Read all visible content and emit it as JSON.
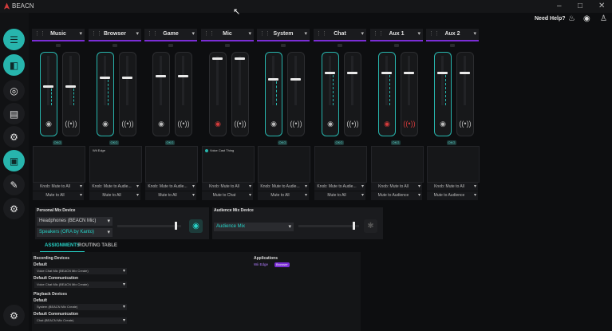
{
  "window": {
    "title": "BEACN",
    "brand_color": "#d13c3c",
    "controls": [
      "minimize-icon",
      "maximize-icon",
      "close-icon"
    ]
  },
  "header": {
    "help_label": "Need Help?",
    "icons": [
      "headset-icon",
      "discord-icon",
      "user-icon"
    ]
  },
  "sidebar": {
    "items": [
      {
        "name": "mixer",
        "icon": "sliders-icon",
        "active": true
      },
      {
        "name": "fader",
        "icon": "fader-icon",
        "active": true
      },
      {
        "name": "fx",
        "icon": "fx-icon",
        "active": false
      },
      {
        "name": "device-settings",
        "icon": "device-gear-icon",
        "active": false
      },
      {
        "name": "settings",
        "icon": "gear-icon",
        "active": false
      },
      {
        "name": "screen",
        "icon": "monitor-icon",
        "active": true
      },
      {
        "name": "edit",
        "icon": "edit-icon",
        "active": false
      },
      {
        "name": "more-settings",
        "icon": "gear-icon",
        "active": false
      },
      {
        "name": "app-settings",
        "icon": "gear-icon",
        "active": false
      }
    ]
  },
  "colors": {
    "accent": "#27b5ad",
    "purple": "#7b2dd6",
    "red": "#d43b3b"
  },
  "channels": [
    {
      "name": "Music",
      "personal_level": 0.4,
      "stream_level": 0.4,
      "personal_muted": false,
      "stream_muted": false,
      "panel_text": "",
      "panel_dot": false,
      "route1": "Knob: Mute to All",
      "route2": "Mute to All",
      "link_label": "OKG",
      "highlight": true
    },
    {
      "name": "Browser",
      "personal_level": 0.58,
      "stream_level": 0.58,
      "personal_muted": false,
      "stream_muted": false,
      "panel_text": "Wii Edge",
      "panel_dot": false,
      "route1": "Knob: Mute to Audie...",
      "route2": "Mute to All",
      "link_label": "OKG",
      "highlight": true
    },
    {
      "name": "Game",
      "personal_level": 0.62,
      "stream_level": 0.62,
      "personal_muted": false,
      "stream_muted": false,
      "panel_text": "",
      "panel_dot": false,
      "route1": "Knob: Mute to Audie...",
      "route2": "Mute to All",
      "link_label": "OKG",
      "highlight": false
    },
    {
      "name": "Mic",
      "personal_level": 0.97,
      "stream_level": 0.97,
      "personal_muted": true,
      "stream_muted": false,
      "panel_text": "Voice Cast Thing",
      "panel_dot": true,
      "route1": "Knob: Mute to All",
      "route2": "Mute to Chat",
      "link_label": "",
      "highlight": false
    },
    {
      "name": "System",
      "personal_level": 0.55,
      "stream_level": 0.55,
      "personal_muted": false,
      "stream_muted": false,
      "panel_text": "",
      "panel_dot": false,
      "route1": "Knob: Mute to Audie...",
      "route2": "Mute to All",
      "link_label": "OKG",
      "highlight": true
    },
    {
      "name": "Chat",
      "personal_level": 0.68,
      "stream_level": 0.68,
      "personal_muted": false,
      "stream_muted": false,
      "panel_text": "",
      "panel_dot": false,
      "route1": "Knob: Mute to Audie...",
      "route2": "Mute to All",
      "link_label": "OKG",
      "highlight": true
    },
    {
      "name": "Aux 1",
      "personal_level": 0.68,
      "stream_level": 0.68,
      "personal_muted": true,
      "stream_muted": true,
      "panel_text": "",
      "panel_dot": false,
      "route1": "Knob: Mute to All",
      "route2": "Mute to Audience",
      "link_label": "OKG",
      "highlight": true
    },
    {
      "name": "Aux 2",
      "personal_level": 0.68,
      "stream_level": 0.68,
      "personal_muted": false,
      "stream_muted": false,
      "panel_text": "",
      "panel_dot": false,
      "route1": "Knob: Mute to All",
      "route2": "Mute to Audience",
      "link_label": "OKG",
      "highlight": true
    }
  ],
  "personal_mix": {
    "title": "Personal Mix Device",
    "device1": "Headphones (BEACN Mic)",
    "device2": "Speakers (ORA by Kanto)",
    "level": 0.9
  },
  "audience_mix": {
    "title": "Audience Mix Device",
    "device": "Audience Mix",
    "level": 0.9
  },
  "tabs": [
    {
      "label": "ASSIGNMENTS",
      "active": true
    },
    {
      "label": "ROUTING TABLE",
      "active": false
    }
  ],
  "assignments": {
    "recording_title": "Recording Devices",
    "recording_default_label": "Default",
    "recording_default_value": "Voice Chat Mic (BEACN Mix Create)",
    "recording_comm_label": "Default Communication",
    "recording_comm_value": "Voice Chat Mic (BEACN Mix Create)",
    "playback_title": "Playback Devices",
    "playback_default_label": "Default",
    "playback_default_value": "System (BEACN Mix Create)",
    "playback_comm_label": "Default Communication",
    "playback_comm_value": "Chat (BEACN Mix Create)"
  },
  "applications": {
    "title": "Applications",
    "app_name": "Wii Edge",
    "app_badge": "Browser"
  }
}
